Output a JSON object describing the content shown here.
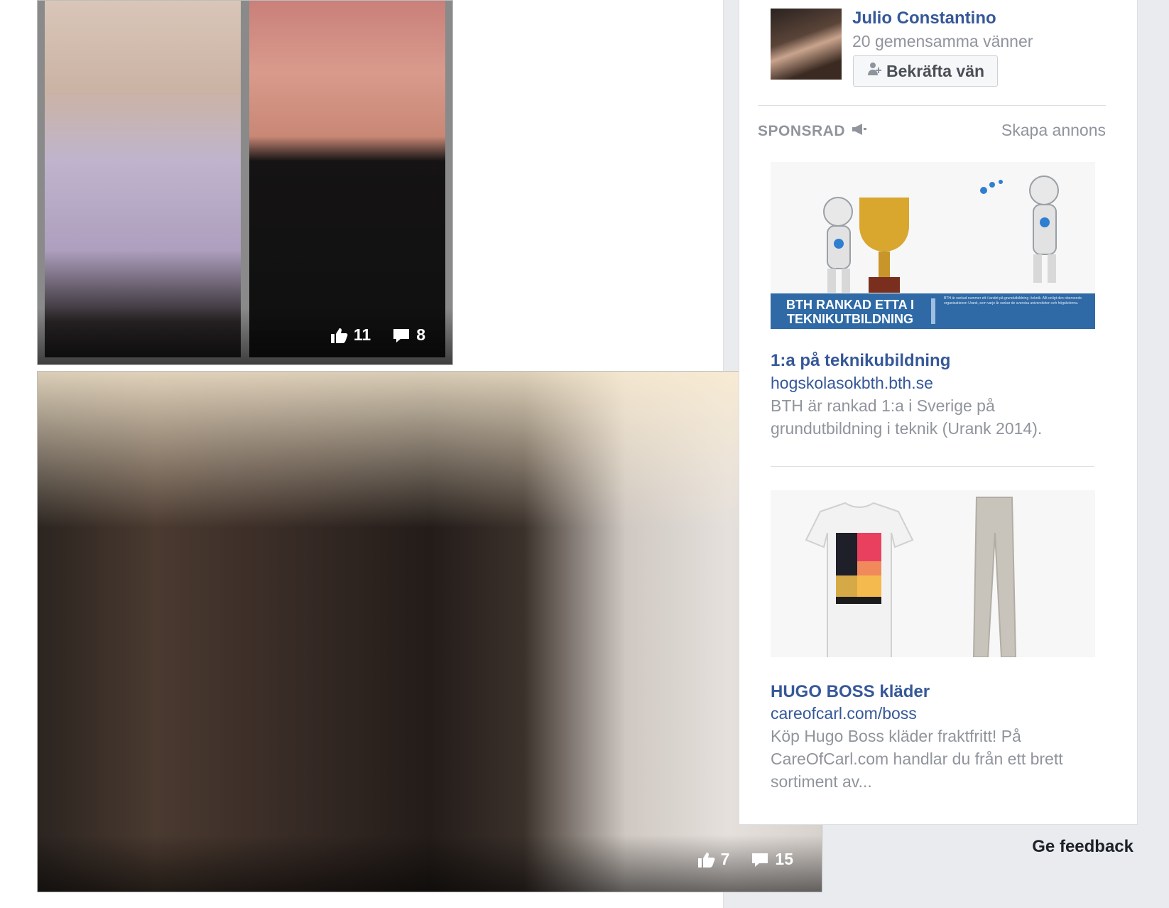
{
  "feed": {
    "photo_top": {
      "likes": "11",
      "comments": "8"
    },
    "photo_group": {
      "likes": "7",
      "comments": "15"
    }
  },
  "sidebar": {
    "friend_request": {
      "name": "Julio Constantino",
      "mutual": "20 gemensamma vänner",
      "confirm_label": "Bekräfta vän"
    },
    "sponsored_label": "SPONSRAD",
    "create_ad": "Skapa annons",
    "ads": [
      {
        "banner_line1": "BTH RANKAD ETTA I",
        "banner_line2": "TEKNIKUTBILDNING",
        "banner_fine": "BTH är rankad nummer ett i landet på grundutbildning i teknik. Allt enligt den oberoende organisationen Urank, som varje år rankar de svenska universiteten och högskolorna.",
        "title": "1:a på teknikubildning",
        "domain": "hogskolasokbth.bth.se",
        "text": "BTH är rankad 1:a i Sverige på grundutbildning i teknik (Urank 2014)."
      },
      {
        "title": "HUGO BOSS kläder",
        "domain": "careofcarl.com/boss",
        "text": "Köp Hugo Boss kläder fraktfritt! På CareOfCarl.com handlar du från ett brett sortiment av..."
      }
    ],
    "feedback": "Ge feedback"
  },
  "colors": {
    "link_blue": "#365899",
    "muted_gray": "#90949c",
    "page_bg": "#e9ebee",
    "banner_blue": "#2f6aa6"
  }
}
